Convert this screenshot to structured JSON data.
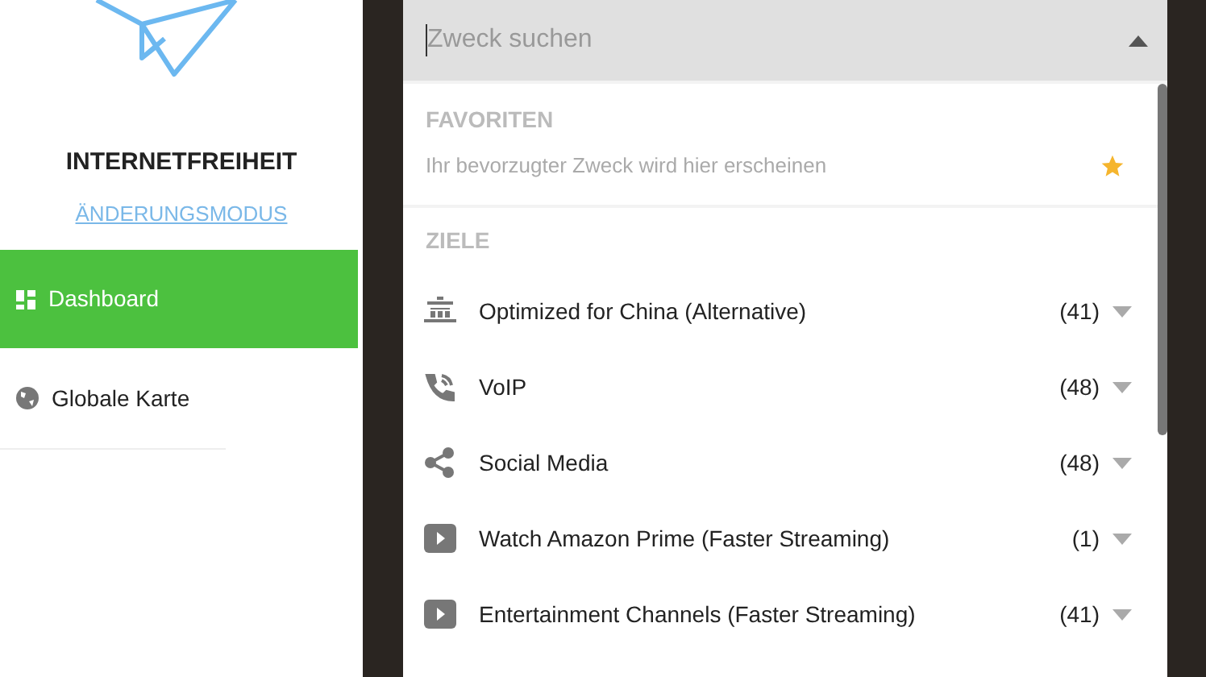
{
  "sidebar": {
    "title": "INTERNETFREIHEIT",
    "mode_link": "ÄNDERUNGSMODUS",
    "items": [
      {
        "label": "Dashboard",
        "kind": "dashboard",
        "selected": true
      },
      {
        "label": "Globale Karte",
        "kind": "globe",
        "selected": false
      }
    ]
  },
  "search": {
    "placeholder": "Zweck suchen",
    "expanded": true
  },
  "favorites": {
    "heading": "FAVORITEN",
    "hint": "Ihr bevorzugter Zweck wird hier erscheinen"
  },
  "targets": {
    "heading": "ZIELE",
    "items": [
      {
        "kind": "pagoda",
        "label": "Optimized for China (Alternative)",
        "count": "(41)"
      },
      {
        "kind": "phone",
        "label": "VoIP",
        "count": "(48)"
      },
      {
        "kind": "share",
        "label": "Social Media",
        "count": "(48)"
      },
      {
        "kind": "play",
        "label": "Watch Amazon Prime (Faster Streaming)",
        "count": "(1)"
      },
      {
        "kind": "play",
        "label": "Entertainment Channels (Faster Streaming)",
        "count": "(41)"
      }
    ]
  }
}
